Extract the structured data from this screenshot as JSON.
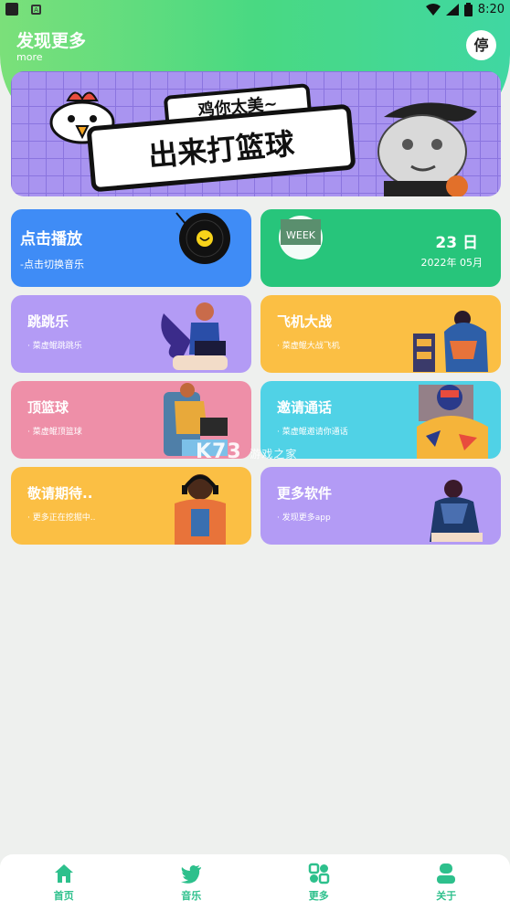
{
  "status_bar": {
    "time": "8:20"
  },
  "header": {
    "title": "发现更多",
    "subtitle": "more",
    "stop_label": "停"
  },
  "banner": {
    "top_text": "鸡你太美~",
    "main_text": "出来打篮球"
  },
  "cards": {
    "play": {
      "title": "点击播放",
      "subtitle": "-点击切换音乐"
    },
    "week": {
      "badge": "WEEK",
      "day": "23 日",
      "month": "2022年 05月"
    },
    "jump": {
      "title": "跳跳乐",
      "subtitle": "· 菜虚鲲跳跳乐"
    },
    "plane": {
      "title": "飞机大战",
      "subtitle": "· 菜虚鲲大战飞机"
    },
    "hoop": {
      "title": "顶篮球",
      "subtitle": "· 菜虚鲲顶篮球"
    },
    "call": {
      "title": "邀请通话",
      "subtitle": "· 菜虚鲲邀请你通话"
    },
    "wait": {
      "title": "敬请期待..",
      "subtitle": "· 更多正在挖掘中.."
    },
    "more": {
      "title": "更多软件",
      "subtitle": "· 发现更多app"
    }
  },
  "watermark": {
    "brand": "K73",
    "tail": "游戏之家"
  },
  "nav": {
    "items": [
      {
        "label": "首页",
        "icon": "home-icon"
      },
      {
        "label": "音乐",
        "icon": "bird-icon"
      },
      {
        "label": "更多",
        "icon": "apps-icon"
      },
      {
        "label": "关于",
        "icon": "user-icon"
      }
    ]
  },
  "colors": {
    "accent": "#2dc08c",
    "header_start": "#7be07a",
    "header_end": "#40d7a2"
  }
}
